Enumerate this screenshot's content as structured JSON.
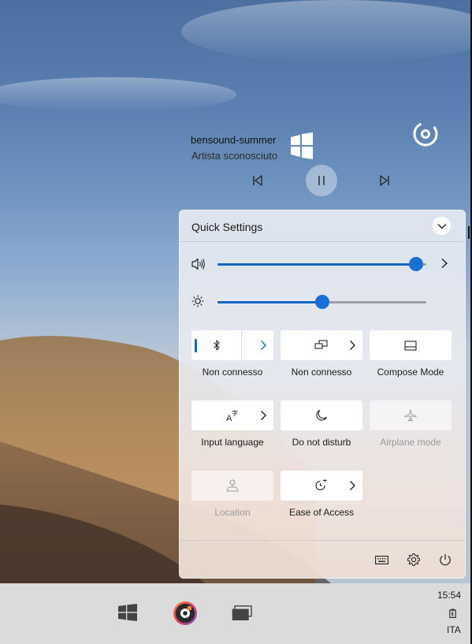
{
  "media": {
    "title": "bensound-summer",
    "artist": "Artista sconosciuto",
    "icons": {
      "prev": "previous-track-icon",
      "pause": "pause-icon",
      "next": "next-track-icon",
      "app": "music-disc-icon"
    }
  },
  "quick_settings": {
    "title": "Quick Settings",
    "volume": {
      "icon": "speaker-icon",
      "level": 0.95
    },
    "brightness": {
      "icon": "sun-icon",
      "level": 0.5
    },
    "tiles": [
      {
        "label": "Non connesso",
        "icon": "bluetooth-icon",
        "has_arrow": true,
        "active": true,
        "disabled": false
      },
      {
        "label": "Non connesso",
        "icon": "network-icon",
        "has_arrow": true,
        "active": false,
        "disabled": false
      },
      {
        "label": "Compose Mode",
        "icon": "compose-mode-icon",
        "has_arrow": false,
        "active": false,
        "disabled": false
      },
      {
        "label": "Input language",
        "icon": "input-language-icon",
        "has_arrow": true,
        "active": false,
        "disabled": false
      },
      {
        "label": "Do not disturb",
        "icon": "moon-icon",
        "has_arrow": false,
        "active": false,
        "disabled": false
      },
      {
        "label": "Airplane mode",
        "icon": "airplane-icon",
        "has_arrow": false,
        "active": false,
        "disabled": true
      },
      {
        "label": "Location",
        "icon": "location-icon",
        "has_arrow": false,
        "active": false,
        "disabled": true
      },
      {
        "label": "Ease of Access",
        "icon": "ease-of-access-icon",
        "has_arrow": true,
        "active": false,
        "disabled": false
      }
    ],
    "footer_icons": [
      "keyboard-icon",
      "settings-gear-icon",
      "power-icon"
    ]
  },
  "taskbar": {
    "time": "15:54",
    "language": "ITA",
    "icons": [
      "windows-start-icon",
      "music-app-icon",
      "task-view-icon",
      "battery-icon"
    ]
  },
  "colors": {
    "accent": "#1565c7",
    "taskbar": "#dcdbdb"
  }
}
